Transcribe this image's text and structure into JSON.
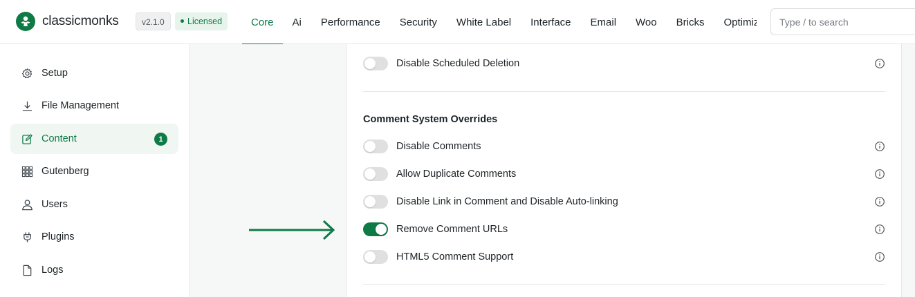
{
  "header": {
    "brand": "classicmonks",
    "version": "v2.1.0",
    "license_status": "Licensed",
    "tabs": [
      {
        "label": "Core",
        "active": true
      },
      {
        "label": "Ai",
        "active": false
      },
      {
        "label": "Performance",
        "active": false
      },
      {
        "label": "Security",
        "active": false
      },
      {
        "label": "White Label",
        "active": false
      },
      {
        "label": "Interface",
        "active": false
      },
      {
        "label": "Email",
        "active": false
      },
      {
        "label": "Woo",
        "active": false
      },
      {
        "label": "Bricks",
        "active": false
      },
      {
        "label": "Optimization",
        "active": false
      }
    ],
    "search_placeholder": "Type / to search"
  },
  "sidebar": {
    "items": [
      {
        "label": "Setup",
        "icon": "gear-icon"
      },
      {
        "label": "File Management",
        "icon": "download-icon"
      },
      {
        "label": "Content",
        "icon": "edit-icon",
        "active": true,
        "badge": "1"
      },
      {
        "label": "Gutenberg",
        "icon": "grid-icon"
      },
      {
        "label": "Users",
        "icon": "user-icon"
      },
      {
        "label": "Plugins",
        "icon": "plug-icon"
      },
      {
        "label": "Logs",
        "icon": "file-icon"
      }
    ]
  },
  "main": {
    "top_setting": {
      "label": "Disable Scheduled Deletion",
      "enabled": false
    },
    "section_title": "Comment System Overrides",
    "settings": [
      {
        "label": "Disable Comments",
        "enabled": false
      },
      {
        "label": "Allow Duplicate Comments",
        "enabled": false
      },
      {
        "label": "Disable Link in Comment and Disable Auto-linking",
        "enabled": false
      },
      {
        "label": "Remove Comment URLs",
        "enabled": true
      },
      {
        "label": "HTML5 Comment Support",
        "enabled": false
      }
    ]
  },
  "colors": {
    "accent": "#0e7a46",
    "toggle_off": "#e0e0e0"
  }
}
